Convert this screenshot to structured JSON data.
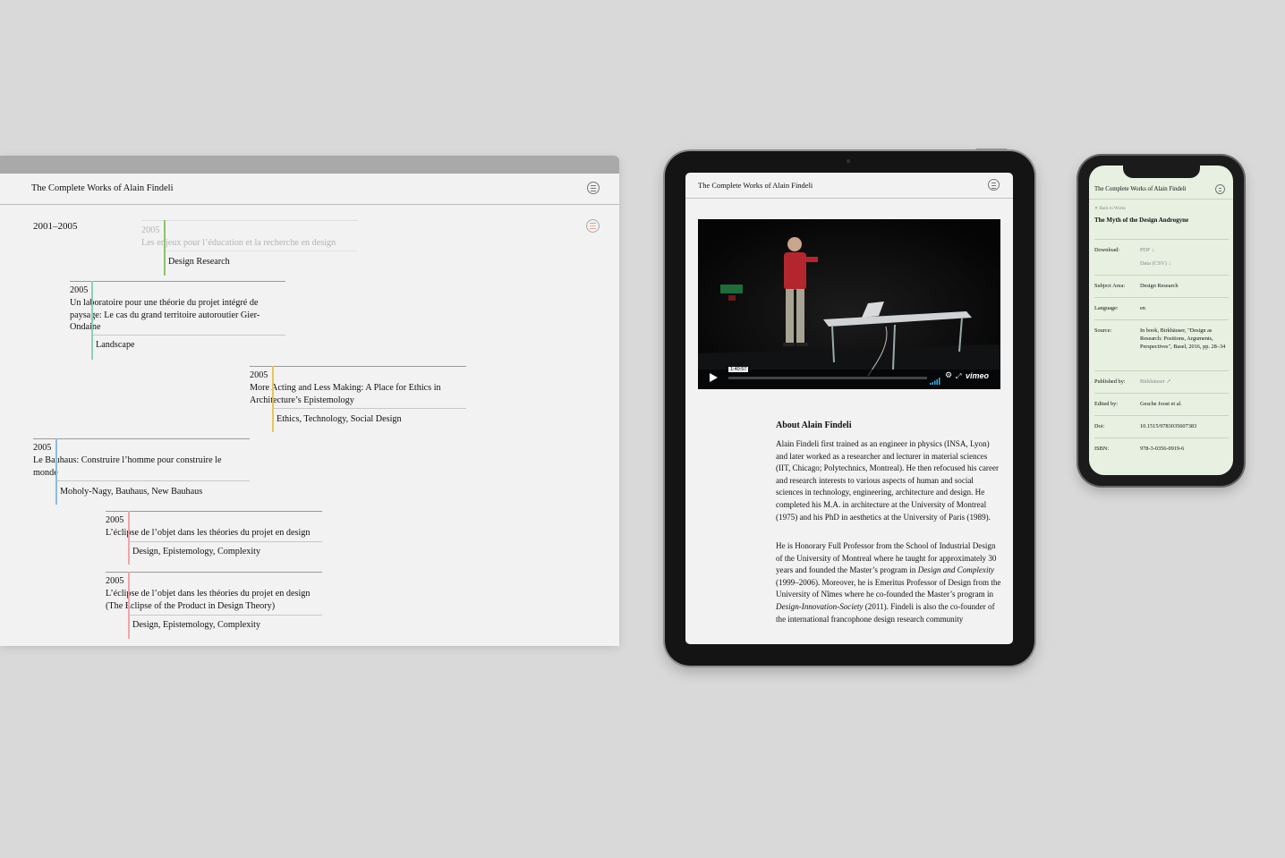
{
  "app": {
    "title": "The Complete Works of Alain Findeli"
  },
  "timeline": {
    "range": "2001–2005",
    "entries": [
      {
        "year": "2005",
        "title": "Les enjeux pour l’éducation et la recherche en design",
        "tags": "Design Research",
        "color": "#8cc46c",
        "faded": true
      },
      {
        "year": "2005",
        "title": "Un laboratoire pour une théorie du projet intégré de paysage: Le cas du grand territoire autoroutier Gier-Ondaine",
        "tags": "Landscape",
        "color": "#8ecfb8"
      },
      {
        "year": "2005",
        "title": "More Acting and Less Making: A Place for Ethics in Architecture’s Epistemology",
        "tags": "Ethics, Technology, Social Design",
        "color": "#e8c45c"
      },
      {
        "year": "2005",
        "title": "Le Bauhaus: Construire l’homme pour construire le monde",
        "tags": "Moholy-Nagy, Bauhaus, New Bauhaus",
        "color": "#8cbcdc"
      },
      {
        "year": "2005",
        "title": "L’éclipse de l’objet dans les théories du projet en design",
        "tags": "Design, Epistemology, Complexity",
        "color": "#eaa8a8"
      },
      {
        "year": "2005",
        "title": "L’éclipse de l’objet dans les théories du projet en design (The Eclipse of the Product in Design Theory)",
        "tags": "Design, Epistemology, Complexity",
        "color": "#eaa8a8"
      }
    ]
  },
  "video": {
    "timecode": "1:40:57",
    "brand": "vimeo"
  },
  "about": {
    "heading": "About Alain Findeli",
    "p1": "Alain Findeli first trained as an engineer in physics (INSA, Lyon) and later worked as a researcher and lecturer in material sciences (IIT, Chicago; Polytechnics, Montreal). He then refocused his career and research interests to various aspects of human and social sciences in technology, engineering, architecture and design. He completed his M.A. in architecture at the University of Montreal (1975) and his PhD in aesthetics at the University of Paris (1989).",
    "p2_a": "He is Honorary Full Professor from the School of Industrial Design of the University of Montreal where he taught for approximately 30 years and founded the Master’s program in ",
    "p2_em1": "Design and Complexity",
    "p2_b": " (1999–2006). Moreover, he is Emeritus Professor of Design from the University of Nîmes where he co-founded the Master’s program in ",
    "p2_em2": "Design-Innovation-Society",
    "p2_c": " (2011). Findeli is also the co-founder of the international francophone design research community"
  },
  "work": {
    "back": "Back to Works",
    "title": "The Myth of the Design Androgyne",
    "download_label": "Download:",
    "pdf": "PDF",
    "csv": "Data (CSV)",
    "rows": [
      {
        "k": "Subject Area:",
        "v": "Design Research"
      },
      {
        "k": "Language:",
        "v": "en"
      },
      {
        "k": "Source:",
        "v": "In book, Birkhäuser, \"Design as Research: Positions, Arguments, Perspectives\", Basel, 2016, pp. 28–34"
      },
      {
        "k": "Published by:",
        "v": "Birkhäuser"
      },
      {
        "k": "Edited by:",
        "v": "Gesche Joost et al."
      },
      {
        "k": "Doi:",
        "v": "10.1515/9783035607383"
      },
      {
        "k": "ISBN:",
        "v": "978-3-0356-0919-6"
      }
    ]
  },
  "icons": [
    "menu-icon",
    "close-icon",
    "download-icon",
    "external-link-icon",
    "play-icon",
    "volume-icon",
    "settings-icon",
    "fullscreen-icon"
  ]
}
